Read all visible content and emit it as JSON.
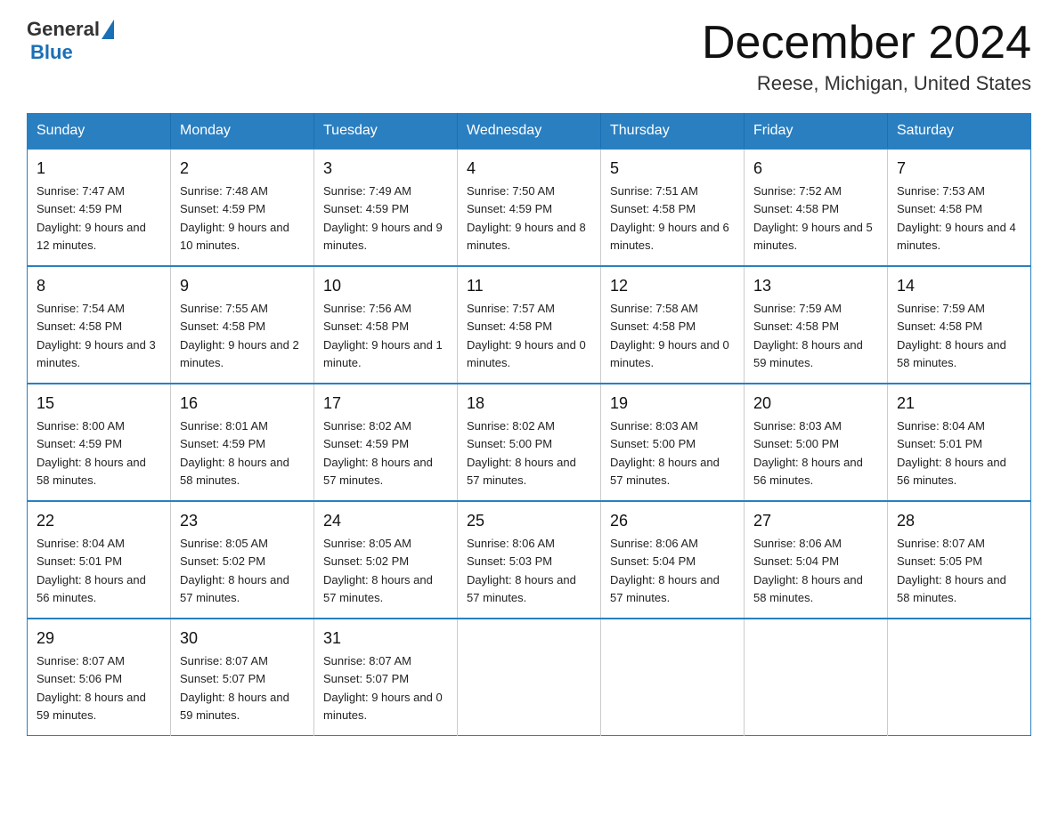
{
  "logo": {
    "general": "General",
    "blue": "Blue"
  },
  "header": {
    "month": "December 2024",
    "location": "Reese, Michigan, United States"
  },
  "weekdays": [
    "Sunday",
    "Monday",
    "Tuesday",
    "Wednesday",
    "Thursday",
    "Friday",
    "Saturday"
  ],
  "weeks": [
    [
      {
        "day": "1",
        "sunrise": "7:47 AM",
        "sunset": "4:59 PM",
        "daylight": "9 hours and 12 minutes."
      },
      {
        "day": "2",
        "sunrise": "7:48 AM",
        "sunset": "4:59 PM",
        "daylight": "9 hours and 10 minutes."
      },
      {
        "day": "3",
        "sunrise": "7:49 AM",
        "sunset": "4:59 PM",
        "daylight": "9 hours and 9 minutes."
      },
      {
        "day": "4",
        "sunrise": "7:50 AM",
        "sunset": "4:59 PM",
        "daylight": "9 hours and 8 minutes."
      },
      {
        "day": "5",
        "sunrise": "7:51 AM",
        "sunset": "4:58 PM",
        "daylight": "9 hours and 6 minutes."
      },
      {
        "day": "6",
        "sunrise": "7:52 AM",
        "sunset": "4:58 PM",
        "daylight": "9 hours and 5 minutes."
      },
      {
        "day": "7",
        "sunrise": "7:53 AM",
        "sunset": "4:58 PM",
        "daylight": "9 hours and 4 minutes."
      }
    ],
    [
      {
        "day": "8",
        "sunrise": "7:54 AM",
        "sunset": "4:58 PM",
        "daylight": "9 hours and 3 minutes."
      },
      {
        "day": "9",
        "sunrise": "7:55 AM",
        "sunset": "4:58 PM",
        "daylight": "9 hours and 2 minutes."
      },
      {
        "day": "10",
        "sunrise": "7:56 AM",
        "sunset": "4:58 PM",
        "daylight": "9 hours and 1 minute."
      },
      {
        "day": "11",
        "sunrise": "7:57 AM",
        "sunset": "4:58 PM",
        "daylight": "9 hours and 0 minutes."
      },
      {
        "day": "12",
        "sunrise": "7:58 AM",
        "sunset": "4:58 PM",
        "daylight": "9 hours and 0 minutes."
      },
      {
        "day": "13",
        "sunrise": "7:59 AM",
        "sunset": "4:58 PM",
        "daylight": "8 hours and 59 minutes."
      },
      {
        "day": "14",
        "sunrise": "7:59 AM",
        "sunset": "4:58 PM",
        "daylight": "8 hours and 58 minutes."
      }
    ],
    [
      {
        "day": "15",
        "sunrise": "8:00 AM",
        "sunset": "4:59 PM",
        "daylight": "8 hours and 58 minutes."
      },
      {
        "day": "16",
        "sunrise": "8:01 AM",
        "sunset": "4:59 PM",
        "daylight": "8 hours and 58 minutes."
      },
      {
        "day": "17",
        "sunrise": "8:02 AM",
        "sunset": "4:59 PM",
        "daylight": "8 hours and 57 minutes."
      },
      {
        "day": "18",
        "sunrise": "8:02 AM",
        "sunset": "5:00 PM",
        "daylight": "8 hours and 57 minutes."
      },
      {
        "day": "19",
        "sunrise": "8:03 AM",
        "sunset": "5:00 PM",
        "daylight": "8 hours and 57 minutes."
      },
      {
        "day": "20",
        "sunrise": "8:03 AM",
        "sunset": "5:00 PM",
        "daylight": "8 hours and 56 minutes."
      },
      {
        "day": "21",
        "sunrise": "8:04 AM",
        "sunset": "5:01 PM",
        "daylight": "8 hours and 56 minutes."
      }
    ],
    [
      {
        "day": "22",
        "sunrise": "8:04 AM",
        "sunset": "5:01 PM",
        "daylight": "8 hours and 56 minutes."
      },
      {
        "day": "23",
        "sunrise": "8:05 AM",
        "sunset": "5:02 PM",
        "daylight": "8 hours and 57 minutes."
      },
      {
        "day": "24",
        "sunrise": "8:05 AM",
        "sunset": "5:02 PM",
        "daylight": "8 hours and 57 minutes."
      },
      {
        "day": "25",
        "sunrise": "8:06 AM",
        "sunset": "5:03 PM",
        "daylight": "8 hours and 57 minutes."
      },
      {
        "day": "26",
        "sunrise": "8:06 AM",
        "sunset": "5:04 PM",
        "daylight": "8 hours and 57 minutes."
      },
      {
        "day": "27",
        "sunrise": "8:06 AM",
        "sunset": "5:04 PM",
        "daylight": "8 hours and 58 minutes."
      },
      {
        "day": "28",
        "sunrise": "8:07 AM",
        "sunset": "5:05 PM",
        "daylight": "8 hours and 58 minutes."
      }
    ],
    [
      {
        "day": "29",
        "sunrise": "8:07 AM",
        "sunset": "5:06 PM",
        "daylight": "8 hours and 59 minutes."
      },
      {
        "day": "30",
        "sunrise": "8:07 AM",
        "sunset": "5:07 PM",
        "daylight": "8 hours and 59 minutes."
      },
      {
        "day": "31",
        "sunrise": "8:07 AM",
        "sunset": "5:07 PM",
        "daylight": "9 hours and 0 minutes."
      },
      null,
      null,
      null,
      null
    ]
  ],
  "labels": {
    "sunrise": "Sunrise:",
    "sunset": "Sunset:",
    "daylight": "Daylight:"
  }
}
